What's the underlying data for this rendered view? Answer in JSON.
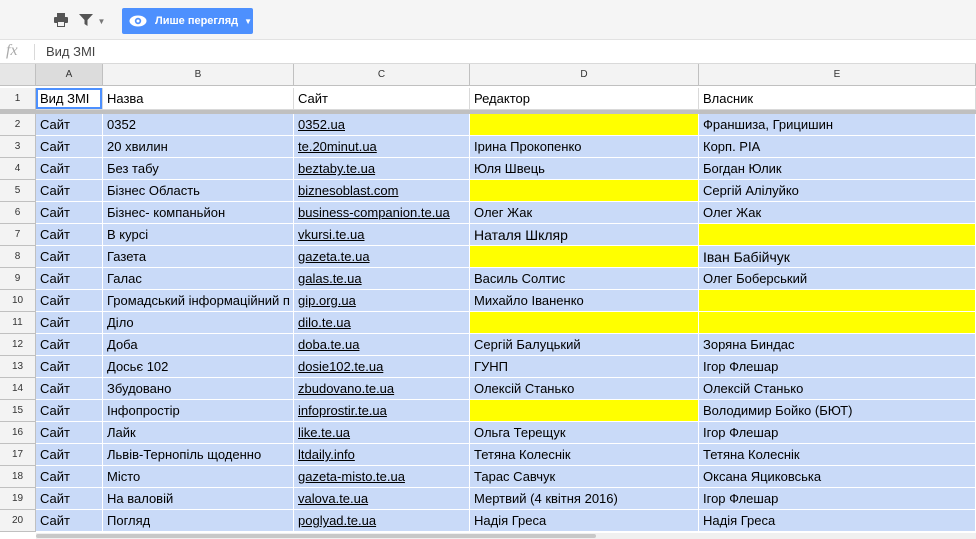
{
  "toolbar": {
    "print_icon": "printer-icon",
    "filter_icon": "filter-icon",
    "view_mode_label": "Лише перегляд"
  },
  "formula_bar": {
    "fx_label": "fx",
    "value": "Вид ЗМІ"
  },
  "columns": [
    "A",
    "B",
    "C",
    "D",
    "E"
  ],
  "header_row": {
    "number": "1",
    "cells": [
      "Вид ЗМІ",
      "Назва",
      "Сайт",
      "Редактор",
      "Власник"
    ]
  },
  "rows": [
    {
      "number": "2",
      "cells": [
        "Сайт",
        "0352",
        "0352.ua",
        "",
        "Франшиза, Грицишин"
      ],
      "highlight": [
        false,
        false,
        false,
        true,
        false
      ]
    },
    {
      "number": "3",
      "cells": [
        "Сайт",
        "20 хвилин",
        "te.20minut.ua",
        "Ірина Прокопенко",
        "Корп. РІА"
      ],
      "highlight": [
        false,
        false,
        false,
        false,
        false
      ]
    },
    {
      "number": "4",
      "cells": [
        "Сайт",
        "Без табу",
        "beztaby.te.ua",
        "Юля Швець",
        "Богдан Юлик"
      ],
      "highlight": [
        false,
        false,
        false,
        false,
        false
      ]
    },
    {
      "number": "5",
      "cells": [
        "Сайт",
        "Бізнес Область",
        "biznesoblast.com",
        "",
        "Сергій Алілуйко"
      ],
      "highlight": [
        false,
        false,
        false,
        true,
        false
      ]
    },
    {
      "number": "6",
      "cells": [
        "Сайт",
        "Бізнес- компаньйон",
        "business-companion.te.ua",
        "Олег Жак",
        "Олег Жак"
      ],
      "highlight": [
        false,
        false,
        false,
        false,
        false
      ]
    },
    {
      "number": "7",
      "cells": [
        "Сайт",
        "В курсі",
        "vkursi.te.ua",
        "Наталя Шкляр",
        ""
      ],
      "highlight": [
        false,
        false,
        false,
        false,
        true
      ]
    },
    {
      "number": "8",
      "cells": [
        "Сайт",
        "Газета",
        "gazeta.te.ua",
        "",
        "Іван Бабійчук"
      ],
      "highlight": [
        false,
        false,
        false,
        true,
        false
      ]
    },
    {
      "number": "9",
      "cells": [
        "Сайт",
        "Галас",
        "galas.te.ua",
        "Василь Солтис",
        "Олег Боберський"
      ],
      "highlight": [
        false,
        false,
        false,
        false,
        false
      ]
    },
    {
      "number": "10",
      "cells": [
        "Сайт",
        "Громадський інформаційний п",
        "gip.org.ua",
        "Михайло Іваненко",
        ""
      ],
      "highlight": [
        false,
        false,
        false,
        false,
        true
      ]
    },
    {
      "number": "11",
      "cells": [
        "Сайт",
        "Діло",
        "dilo.te.ua",
        "",
        ""
      ],
      "highlight": [
        false,
        false,
        false,
        true,
        true
      ]
    },
    {
      "number": "12",
      "cells": [
        "Сайт",
        "Доба",
        "doba.te.ua",
        "Сергій Балуцький",
        "Зоряна Биндас"
      ],
      "highlight": [
        false,
        false,
        false,
        false,
        false
      ]
    },
    {
      "number": "13",
      "cells": [
        "Сайт",
        "Досьє 102",
        "dosie102.te.ua",
        "ГУНП",
        "Ігор Флешар"
      ],
      "highlight": [
        false,
        false,
        false,
        false,
        false
      ]
    },
    {
      "number": "14",
      "cells": [
        "Сайт",
        "Збудовано",
        "zbudovano.te.ua",
        "Олексій Станько",
        "Олексій Станько"
      ],
      "highlight": [
        false,
        false,
        false,
        false,
        false
      ]
    },
    {
      "number": "15",
      "cells": [
        "Сайт",
        "Інфопростір",
        "infoprostir.te.ua",
        "",
        "Володимир Бойко (БЮТ)"
      ],
      "highlight": [
        false,
        false,
        false,
        true,
        false
      ]
    },
    {
      "number": "16",
      "cells": [
        "Сайт",
        "Лайк",
        "like.te.ua",
        "Ольга Терещук",
        "Ігор Флешар"
      ],
      "highlight": [
        false,
        false,
        false,
        false,
        false
      ]
    },
    {
      "number": "17",
      "cells": [
        "Сайт",
        "Львів-Тернопіль щоденно",
        "ltdaily.info",
        "Тетяна Колеснік",
        "Тетяна Колеснік"
      ],
      "highlight": [
        false,
        false,
        false,
        false,
        false
      ]
    },
    {
      "number": "18",
      "cells": [
        "Сайт",
        "Місто",
        "gazeta-misto.te.ua",
        "Тарас Савчук",
        "Оксана Яциковська"
      ],
      "highlight": [
        false,
        false,
        false,
        false,
        false
      ]
    },
    {
      "number": "19",
      "cells": [
        "Сайт",
        "На валовій",
        "valova.te.ua",
        "Мертвий (4 квітня 2016)",
        "Ігор Флешар"
      ],
      "highlight": [
        false,
        false,
        false,
        false,
        false
      ]
    },
    {
      "number": "20",
      "cells": [
        "Сайт",
        "Погляд",
        "poglyad.te.ua",
        "Надія Греса",
        "Надія Греса"
      ],
      "highlight": [
        false,
        false,
        false,
        false,
        false
      ]
    }
  ],
  "colors": {
    "row_fill": "#c9daf8",
    "highlight_fill": "#ffff00",
    "accent": "#4d90fe"
  }
}
